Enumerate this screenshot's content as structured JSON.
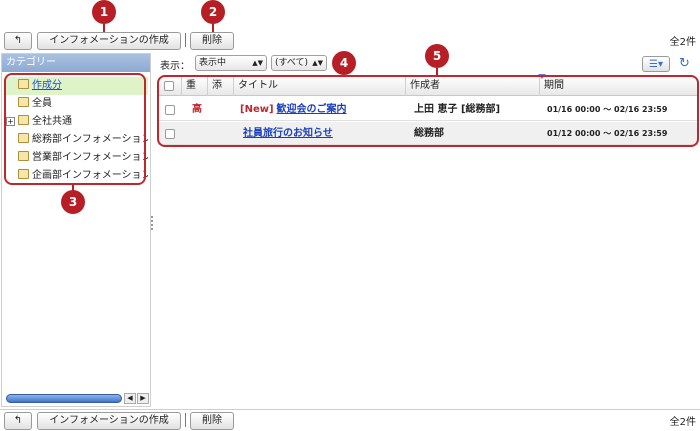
{
  "toolbar": {
    "back_icon": "back-arrow-icon",
    "create_label": "インフォメーションの作成",
    "delete_label": "削除",
    "count_label": "全2件"
  },
  "callouts": [
    "1",
    "2",
    "3",
    "4",
    "5"
  ],
  "sidebar": {
    "header": "カテゴリー",
    "items": [
      {
        "label": "作成分",
        "selected": true,
        "expandable": false
      },
      {
        "label": "全員",
        "selected": false,
        "expandable": false
      },
      {
        "label": "全社共通",
        "selected": false,
        "expandable": true,
        "expander": "+"
      },
      {
        "label": "総務部インフォメーション",
        "selected": false,
        "expandable": false
      },
      {
        "label": "営業部インフォメーション",
        "selected": false,
        "expandable": false
      },
      {
        "label": "企画部インフォメーション",
        "selected": false,
        "expandable": false
      }
    ]
  },
  "filter": {
    "label": "表示：",
    "status_value": "表示中",
    "scope_value": "(すべて)"
  },
  "table": {
    "headers": {
      "importance": "重",
      "attachment": "添",
      "title": "タイトル",
      "author": "作成者",
      "period": "期間"
    },
    "rows": [
      {
        "importance": "高",
        "new_tag": "[New]",
        "title": "歓迎会のご案内",
        "author": "上田 恵子 [総務部]",
        "period": "01/16 00:00 〜 02/16 23:59"
      },
      {
        "importance": "",
        "new_tag": "",
        "title": "社員旅行のお知らせ",
        "author": "総務部",
        "period": "01/12 00:00 〜 02/16 23:59"
      }
    ]
  },
  "colors": {
    "accent_red": "#b71f26",
    "link_blue": "#1a3fbd",
    "sidebar_header": "#9ab3d9",
    "selected_bg": "#dff3c8"
  }
}
